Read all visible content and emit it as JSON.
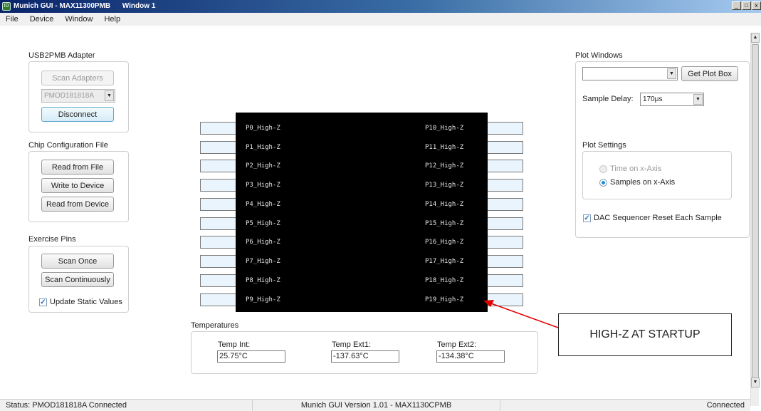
{
  "window": {
    "title": "Munich GUI - MAX11300PMB      Window 1",
    "min_icon": "_",
    "max_icon": "□",
    "close_icon": "x",
    "app_icon": "ID"
  },
  "menu": [
    "File",
    "Device",
    "Window",
    "Help"
  ],
  "adapter": {
    "title": "USB2PMB Adapter",
    "scan_label": "Scan Adapters",
    "selected": "PMOD181818A",
    "disconnect_label": "Disconnect"
  },
  "config": {
    "title": "Chip Configuration File",
    "read_file": "Read from File",
    "write_device": "Write to Device",
    "read_device": "Read from Device"
  },
  "exercise": {
    "title": "Exercise Pins",
    "scan_once": "Scan Once",
    "scan_cont": "Scan Continuously",
    "update_static": "Update Static Values",
    "update_static_checked": true
  },
  "pins_left": [
    "P0_High-Z",
    "P1_High-Z",
    "P2_High-Z",
    "P3_High-Z",
    "P4_High-Z",
    "P5_High-Z",
    "P6_High-Z",
    "P7_High-Z",
    "P8_High-Z",
    "P9_High-Z"
  ],
  "pins_right": [
    "P10_High-Z",
    "P11_High-Z",
    "P12_High-Z",
    "P13_High-Z",
    "P14_High-Z",
    "P15_High-Z",
    "P16_High-Z",
    "P17_High-Z",
    "P18_High-Z",
    "P19_High-Z"
  ],
  "temperatures": {
    "title": "Temperatures",
    "int_label": "Temp Int:",
    "int_value": "25.75°C",
    "ext1_label": "Temp Ext1:",
    "ext1_value": "-137.63°C",
    "ext2_label": "Temp Ext2:",
    "ext2_value": "-134.38°C"
  },
  "plot": {
    "title": "Plot Windows",
    "get_plot_box": "Get Plot Box",
    "sample_delay_label": "Sample Delay:",
    "sample_delay_value": "170μs",
    "settings_title": "Plot Settings",
    "time_x": "Time on x-Axis",
    "samples_x": "Samples on x-Axis",
    "selected_axis": "samples",
    "dac_reset": "DAC Sequencer Reset Each Sample",
    "dac_reset_checked": true
  },
  "annotation": {
    "text": "HIGH-Z AT STARTUP",
    "arrow_color": "#e00000"
  },
  "status": {
    "left": "Status: PMOD181818A Connected",
    "center": "Munich GUI Version 1.01 - MAX1130CPMB",
    "right": "Connected"
  },
  "colors": {
    "title_gradient_start": "#0a246a",
    "pin_panel": "#000000",
    "pin_field": "#eaf4fc"
  }
}
